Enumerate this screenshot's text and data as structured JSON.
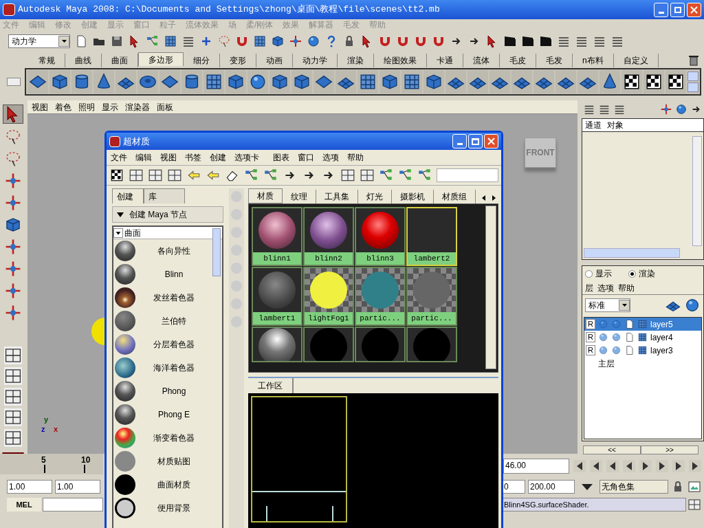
{
  "window": {
    "title": "Autodesk Maya 2008: C:\\Documents and Settings\\zhong\\桌面\\教程\\file\\scenes\\tt2.mb"
  },
  "menu_bar": [
    "文件",
    "编辑",
    "修改",
    "创建",
    "显示",
    "窗口",
    "粒子",
    "流体效果",
    "场",
    "柔/刚体",
    "效果",
    "解算器",
    "毛发",
    "帮助"
  ],
  "status_line": {
    "menu_set": "动力学"
  },
  "shelf_tabs": [
    {
      "label": "常规",
      "selected": false
    },
    {
      "label": "曲线",
      "selected": false
    },
    {
      "label": "曲面",
      "selected": false
    },
    {
      "label": "多边形",
      "selected": true
    },
    {
      "label": "细分",
      "selected": false
    },
    {
      "label": "变形",
      "selected": false
    },
    {
      "label": "动画",
      "selected": false
    },
    {
      "label": "动力学",
      "selected": false
    },
    {
      "label": "渲染",
      "selected": false
    },
    {
      "label": "绘图效果",
      "selected": false
    },
    {
      "label": "卡通",
      "selected": false
    },
    {
      "label": "流体",
      "selected": false
    },
    {
      "label": "毛皮",
      "selected": false
    },
    {
      "label": "毛发",
      "selected": false
    },
    {
      "label": "n布料",
      "selected": false
    },
    {
      "label": "自定义",
      "selected": false
    }
  ],
  "panel_menu": [
    "视图",
    "着色",
    "照明",
    "显示",
    "渲染器",
    "面板"
  ],
  "viewport": {
    "view_cube": "FRONT",
    "axes": [
      "y",
      "z",
      "x"
    ]
  },
  "hypershade": {
    "title": "超材质",
    "menu": [
      "文件",
      "编辑",
      "视图",
      "书签",
      "创建",
      "选项卡",
      "图表",
      "窗口",
      "选项",
      "帮助"
    ],
    "create_tabs": [
      {
        "label": "创建",
        "selected": true
      },
      {
        "label": "库",
        "selected": false
      }
    ],
    "create_header": "创建 Maya 节点",
    "category": "曲面",
    "nodes": [
      {
        "label": "各向异性",
        "kind": "glossy"
      },
      {
        "label": "Blinn",
        "kind": "glossy"
      },
      {
        "label": "发丝着色器",
        "kind": "hair"
      },
      {
        "label": "兰伯特",
        "kind": "matte"
      },
      {
        "label": "分层着色器",
        "kind": "layered"
      },
      {
        "label": "海洋着色器",
        "kind": "ocean"
      },
      {
        "label": "Phong",
        "kind": "glossy"
      },
      {
        "label": "Phong E",
        "kind": "glossy"
      },
      {
        "label": "渐变着色器",
        "kind": "ramp"
      },
      {
        "label": "材质贴图",
        "kind": "flat"
      },
      {
        "label": "曲面材质",
        "kind": "black"
      },
      {
        "label": "便用背景",
        "kind": "ring"
      }
    ],
    "tabs": [
      {
        "label": "材质",
        "selected": true
      },
      {
        "label": "纹理",
        "selected": false
      },
      {
        "label": "工具集",
        "selected": false
      },
      {
        "label": "灯光",
        "selected": false
      },
      {
        "label": "摄影机",
        "selected": false
      },
      {
        "label": "材质组",
        "selected": false
      }
    ],
    "swatches": [
      {
        "label": "blinn1",
        "kind": "pink",
        "selected": false
      },
      {
        "label": "blinn2",
        "kind": "purple",
        "selected": false
      },
      {
        "label": "blinn3",
        "kind": "red",
        "selected": false
      },
      {
        "label": "lambert2",
        "kind": "empty",
        "selected": true
      },
      {
        "label": "lambert1",
        "kind": "gray",
        "selected": false
      },
      {
        "label": "lightFog1",
        "kind": "fog",
        "selected": false
      },
      {
        "label": "partic...",
        "kind": "cloud",
        "selected": false
      },
      {
        "label": "partic...",
        "kind": "smoke",
        "selected": false
      },
      {
        "kind": "light",
        "selected": false
      },
      {
        "kind": "dark",
        "selected": false
      },
      {
        "kind": "dark",
        "selected": false
      },
      {
        "kind": "dark",
        "selected": false
      }
    ],
    "work_area_tab": "工作区"
  },
  "channel_box": {
    "menu": [
      "通道",
      "对象"
    ]
  },
  "layer_editor": {
    "modes": [
      {
        "label": "显示",
        "selected": false
      },
      {
        "label": "渲染",
        "selected": true
      }
    ],
    "menu": [
      "层",
      "选项",
      "帮助"
    ],
    "filter": "标准",
    "layers": [
      {
        "flag": "R",
        "name": "layer5",
        "selected": true
      },
      {
        "flag": "R",
        "name": "layer4",
        "selected": false
      },
      {
        "flag": "R",
        "name": "layer3",
        "selected": false
      }
    ],
    "master": "主层",
    "pager": [
      "<<",
      ">>"
    ]
  },
  "time_slider": {
    "ticks": [
      "5",
      "10"
    ],
    "current_time": "46.00"
  },
  "range_slider": {
    "start": "1.00",
    "playback_start": "1.00",
    "playback_end": "0",
    "end": "200.00",
    "character_set": "无角色集"
  },
  "command_line": {
    "label": "MEL",
    "result": "Blinn4SG.surfaceShader."
  }
}
